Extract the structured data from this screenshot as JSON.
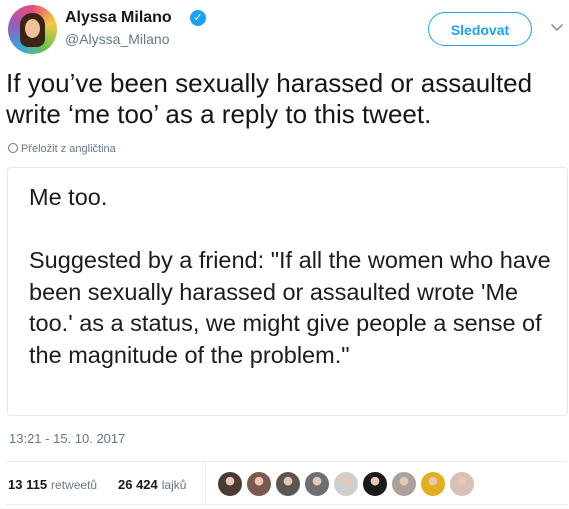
{
  "author": {
    "name": "Alyssa Milano",
    "handle": "@Alyssa_Milano",
    "verified_mark": "✓",
    "follow_label": "Sledovat",
    "menu_chevron": "⌄"
  },
  "tweet": {
    "text": "If you’ve been sexually harassed or assaulted write ‘me too’ as a reply to this tweet.",
    "translate_label": "Přeložit z angličtina"
  },
  "media": {
    "line1": "Me too.",
    "line2": "Suggested by a friend: \"If all the women who have been sexually harassed or assaulted wrote 'Me too.' as a status, we might give people a sense of the magnitude of the problem.\""
  },
  "meta": {
    "timestamp": "13:21 - 15. 10. 2017"
  },
  "stats": {
    "retweets_count": "13 115",
    "retweets_label": "retweetů",
    "likes_count": "26 424",
    "likes_label": "lajků"
  },
  "likers": [
    {
      "color": "#4a3b36"
    },
    {
      "color": "#7a5a50"
    },
    {
      "color": "#5c5652"
    },
    {
      "color": "#6f6f72"
    },
    {
      "color": "#cfcfcf"
    },
    {
      "color": "#1a1a1a"
    },
    {
      "color": "#a9a29c"
    },
    {
      "color": "#e0b020"
    },
    {
      "color": "#d8c0b8"
    }
  ],
  "icons": {
    "verified": "verified-badge-icon",
    "chevron": "chevron-down-icon",
    "globe": "globe-icon"
  }
}
